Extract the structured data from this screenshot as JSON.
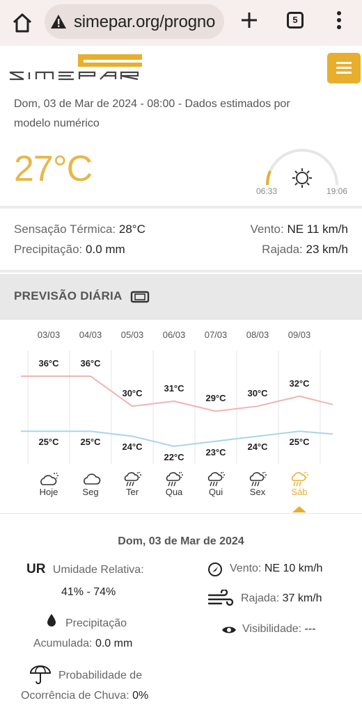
{
  "browser": {
    "url": "simepar.org/progno",
    "tab_count": "5"
  },
  "header": {
    "logo_text": "SIMEPAR",
    "colors": {
      "brand": "#e8ae2e"
    }
  },
  "current": {
    "datetime_text": "Dom, 03 de Mar de 2024 - 08:00 - Dados estimados por modelo numérico",
    "temperature": "27°C",
    "sunrise": "06:33",
    "sunset": "19:06",
    "feels_like_label": "Sensação Térmica:",
    "feels_like_value": "28°C",
    "wind_label": "Vento:",
    "wind_value": "NE 11 km/h",
    "precip_label": "Precipitação:",
    "precip_value": "0.0 mm",
    "gust_label": "Rajada:",
    "gust_value": "23 km/h"
  },
  "daily": {
    "title": "PREVISÃO DIÁRIA",
    "days": [
      {
        "date": "03/03",
        "max": "36°C",
        "min": "25°C",
        "label": "Hoje",
        "icon": "cloud-sun-icon"
      },
      {
        "date": "04/03",
        "max": "36°C",
        "min": "25°C",
        "label": "Seg",
        "icon": "cloud-icon"
      },
      {
        "date": "05/03",
        "max": "30°C",
        "min": "24°C",
        "label": "Ter",
        "icon": "rain-sun-icon"
      },
      {
        "date": "06/03",
        "max": "31°C",
        "min": "22°C",
        "label": "Qua",
        "icon": "rain-sun-icon"
      },
      {
        "date": "07/03",
        "max": "29°C",
        "min": "23°C",
        "label": "Qui",
        "icon": "rain-sun-icon"
      },
      {
        "date": "08/03",
        "max": "30°C",
        "min": "24°C",
        "label": "Sex",
        "icon": "rain-sun-icon"
      },
      {
        "date": "09/03",
        "max": "32°C",
        "min": "25°C",
        "label": "Sáb",
        "icon": "rain-sun-icon"
      }
    ],
    "selected_index": 6,
    "colors": {
      "max_line": "#f0b3b3",
      "min_line": "#a9d3ee"
    }
  },
  "detail": {
    "date": "Dom, 03 de Mar de 2024",
    "ur_abbr": "UR",
    "humidity_label": "Umidade Relativa:",
    "humidity_value": "41% - 74%",
    "precip_label_1": "Precipitação",
    "precip_label_2": "Acumulada:",
    "precip_value": "0.0 mm",
    "rain_prob_label_1": "Probabilidade de",
    "rain_prob_label_2": "Ocorrência de Chuva:",
    "rain_prob_value": "0%",
    "wind_label": "Vento:",
    "wind_value": "NE 10 km/h",
    "gust_label": "Rajada:",
    "gust_value": "37 km/h",
    "visibility_label": "Visibilidade:",
    "visibility_value": "---"
  }
}
